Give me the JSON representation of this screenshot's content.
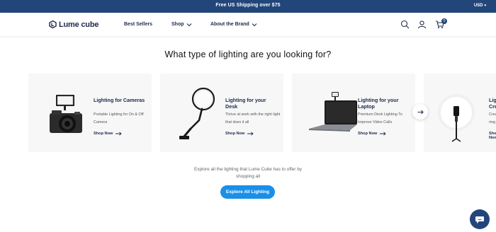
{
  "promo": {
    "text": "Free US Shipping over $75",
    "currency": "USD"
  },
  "brand": {
    "name": "Lume cube"
  },
  "nav": {
    "items": [
      {
        "label": "Best Sellers"
      },
      {
        "label": "Shop"
      },
      {
        "label": "About the Brand"
      }
    ],
    "cart_count": "0",
    "icons": [
      "search-icon",
      "account-icon",
      "cart-icon"
    ]
  },
  "section": {
    "title": "What type of lighting are you looking for?"
  },
  "cards": [
    {
      "title": "Lighting for Cameras",
      "description": "Portable Lighting for On & Off Camera",
      "cta": "Shop Now"
    },
    {
      "title": "Lighting for your Desk",
      "description": "Thrive at work with the right light that does it all",
      "cta": "Shop Now"
    },
    {
      "title": "Lighting for your Laptop",
      "description": "Premium Desk Lighting To Improve Video Calls",
      "cta": "Shop Now"
    },
    {
      "title": "Lighting for Content Creators",
      "description": "Create beautiful content with ring lights",
      "cta": "Shop Now"
    }
  ],
  "explore": {
    "text": "Explore all the lighting that Lume Cube has to offer by shopping all",
    "button": "Explore All Lighting"
  },
  "colors": {
    "navy": "#22467a",
    "button_blue": "#1a8fe8",
    "card_bg": "#f7f7f7"
  }
}
